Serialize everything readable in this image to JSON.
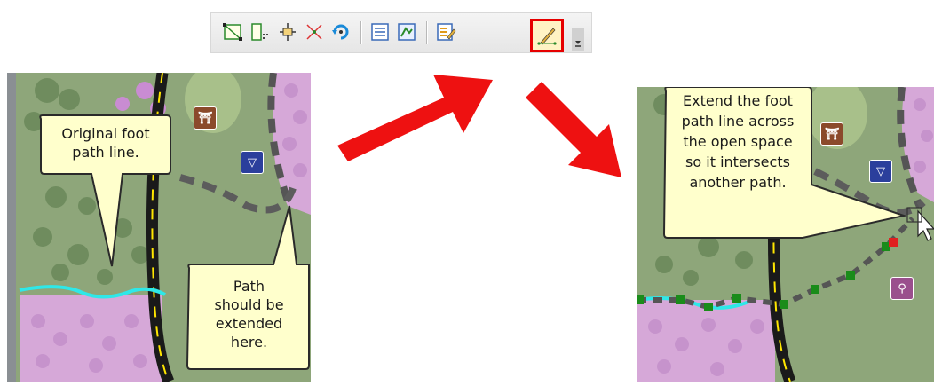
{
  "toolbar": {
    "buttons": [
      {
        "name": "vertices-tool-icon"
      },
      {
        "name": "reshape-tool-icon"
      },
      {
        "name": "split-tool-icon"
      },
      {
        "name": "intersection-tool-icon"
      },
      {
        "name": "rotate-tool-icon"
      },
      {
        "name": "attributes-icon"
      },
      {
        "name": "sketch-properties-icon"
      },
      {
        "name": "create-features-icon"
      },
      {
        "name": "edit-tool-pencil-icon"
      }
    ],
    "active_button_color": "#e60000"
  },
  "left_map": {
    "callout_original": [
      "Original foot",
      "path line."
    ],
    "callout_extend_here": [
      "Path",
      "should be",
      "extended",
      "here."
    ]
  },
  "right_map": {
    "callout_extend": [
      "Extend the foot",
      "path line across",
      "the open space",
      "so it intersects",
      "another path."
    ]
  },
  "colors": {
    "arrow": "#ee1111",
    "callout_fill": "#ffffcc",
    "foot_path": "#2ee8e8",
    "sketch_vertex": "#1a8c1a",
    "road": "#1a1a1a",
    "road_stripe": "#ffe600"
  }
}
